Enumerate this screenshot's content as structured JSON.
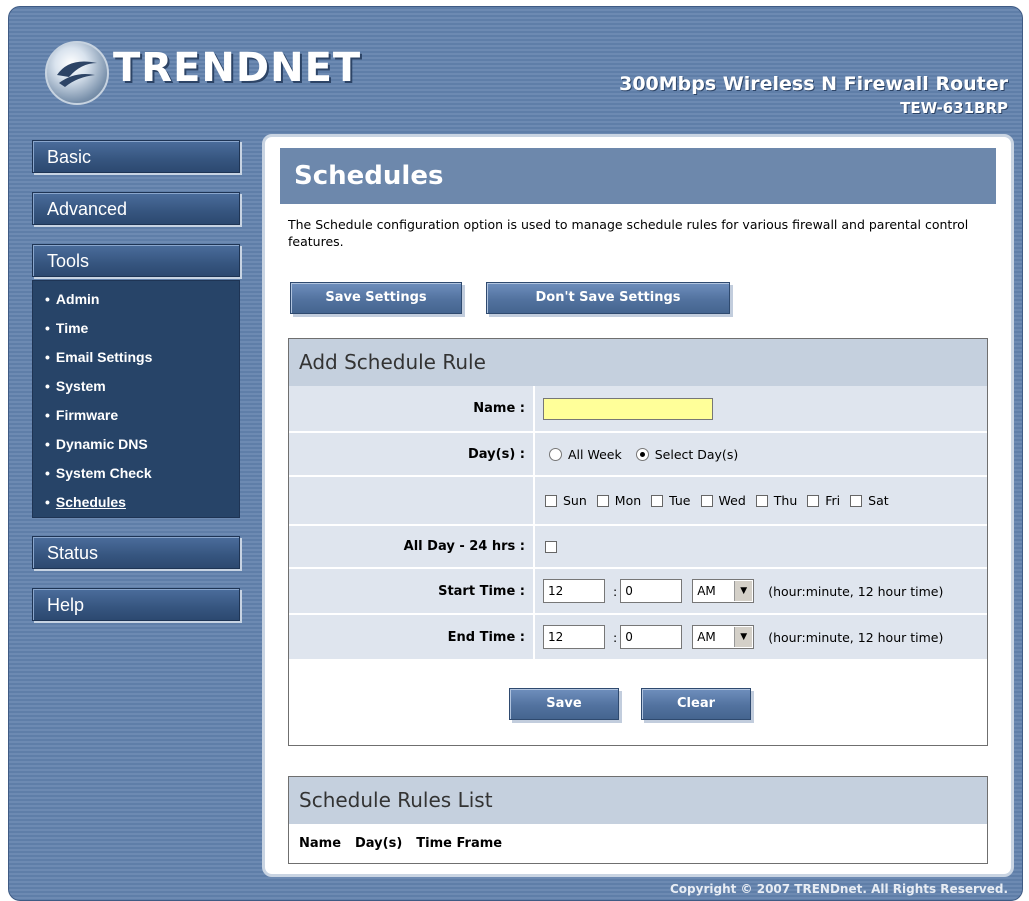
{
  "header": {
    "logo_text": "TRENDNET",
    "product_title": "300Mbps Wireless N Firewall Router",
    "product_model": "TEW-631BRP"
  },
  "sidebar": {
    "basic": "Basic",
    "advanced": "Advanced",
    "tools": "Tools",
    "tools_items": [
      {
        "label": "Admin"
      },
      {
        "label": "Time"
      },
      {
        "label": "Email Settings"
      },
      {
        "label": "System"
      },
      {
        "label": "Firmware"
      },
      {
        "label": "Dynamic DNS"
      },
      {
        "label": "System Check"
      },
      {
        "label": "Schedules"
      }
    ],
    "status": "Status",
    "help": "Help"
  },
  "main": {
    "title": "Schedules",
    "description": "The Schedule configuration option is used to manage schedule rules for various firewall and parental control features.",
    "save_settings": "Save Settings",
    "dont_save_settings": "Don't Save Settings"
  },
  "add_rule": {
    "title": "Add Schedule Rule",
    "name_label": "Name :",
    "name_value": "",
    "days_label": "Day(s) :",
    "all_week": "All Week",
    "select_days": "Select Day(s)",
    "days": [
      "Sun",
      "Mon",
      "Tue",
      "Wed",
      "Thu",
      "Fri",
      "Sat"
    ],
    "all_day_label": "All Day - 24 hrs :",
    "start_label": "Start Time :",
    "start_hour": "12",
    "start_minute": "0",
    "start_ampm": "AM",
    "end_label": "End Time :",
    "end_hour": "12",
    "end_minute": "0",
    "end_ampm": "AM",
    "colon": ":",
    "time_hint": "(hour:minute, 12 hour time)",
    "save": "Save",
    "clear": "Clear"
  },
  "rules_list": {
    "title": "Schedule Rules List",
    "col_name": "Name",
    "col_days": "Day(s)",
    "col_time": "Time Frame"
  },
  "footer": {
    "copyright": "Copyright © 2007 TRENDnet. All Rights Reserved."
  },
  "colors": {
    "frame": "#6d8ab2",
    "nav": "#36557f",
    "title_bar": "#6d88ac",
    "section_header": "#c5d0de",
    "row_bg": "#dfe5ee",
    "name_input": "#ffff99"
  }
}
